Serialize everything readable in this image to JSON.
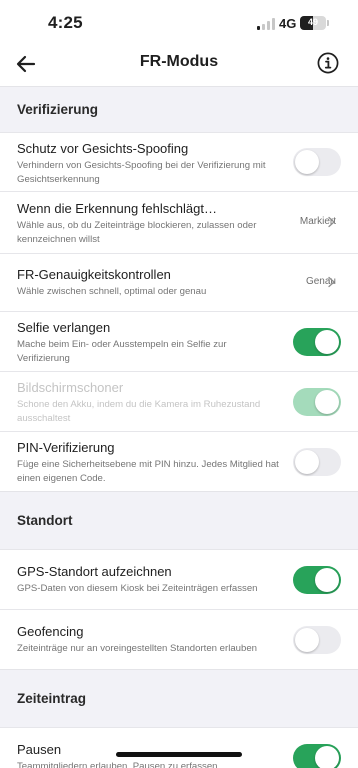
{
  "status_bar": {
    "time": "4:25",
    "network": "4G",
    "battery_label": "49",
    "battery_level": 0.49,
    "signal_bars_active": 1
  },
  "nav": {
    "back_icon": "arrow-left-icon",
    "title": "FR-Modus",
    "info_icon": "info-circle-icon"
  },
  "sections": {
    "verification": {
      "title": "Verifizierung",
      "rows": [
        {
          "title": "Schutz vor Gesichts-Spoofing",
          "subtitle": "Verhindern von Gesichts-Spoofing bei der Verifizierung mit Gesichtserkennung",
          "control": "toggle",
          "checked": false,
          "enabled": true
        },
        {
          "title": "Wenn die Erkennung fehlschlägt…",
          "subtitle": "Wähle aus, ob du Zeiteinträge blockieren, zulassen oder kennzeichnen willst",
          "control": "link",
          "value": "Markiert",
          "enabled": true
        },
        {
          "title": "FR-Genauigkeitskontrollen",
          "subtitle": "Wähle zwischen schnell, optimal oder genau",
          "control": "link",
          "value": "Genau",
          "enabled": true
        },
        {
          "title": "Selfie verlangen",
          "subtitle": "Mache beim Ein- oder Ausstempeln ein Selfie zur Verifizierung",
          "control": "toggle",
          "checked": true,
          "enabled": true
        },
        {
          "title": "Bildschirmschoner",
          "subtitle": "Schone den Akku, indem du die Kamera im Ruhezustand ausschaltest",
          "control": "toggle",
          "checked": true,
          "enabled": false
        },
        {
          "title": "PIN-Verifizierung",
          "subtitle": "Füge eine Sicherheitsebene mit PIN hinzu. Jedes Mitglied hat einen eigenen Code.",
          "control": "toggle",
          "checked": false,
          "enabled": true
        }
      ]
    },
    "location": {
      "title": "Standort",
      "rows": [
        {
          "title": "GPS-Standort aufzeichnen",
          "subtitle": "GPS-Daten von diesem Kiosk bei Zeiteinträgen erfassen",
          "control": "toggle",
          "checked": true,
          "enabled": true
        },
        {
          "title": "Geofencing",
          "subtitle": "Zeiteinträge nur an voreingestellten Standorten erlauben",
          "control": "toggle",
          "checked": false,
          "enabled": true
        }
      ]
    },
    "time_entry": {
      "title": "Zeiteintrag",
      "rows": [
        {
          "title": "Pausen",
          "subtitle": "Teammitgliedern erlauben, Pausen zu erfassen",
          "control": "toggle",
          "checked": true,
          "enabled": true
        }
      ]
    }
  },
  "colors": {
    "toggle_on": "#28a35a",
    "toggle_on_disabled": "#a4dbbb",
    "toggle_off": "#ebebef",
    "section_bg": "#f2f2f7"
  }
}
